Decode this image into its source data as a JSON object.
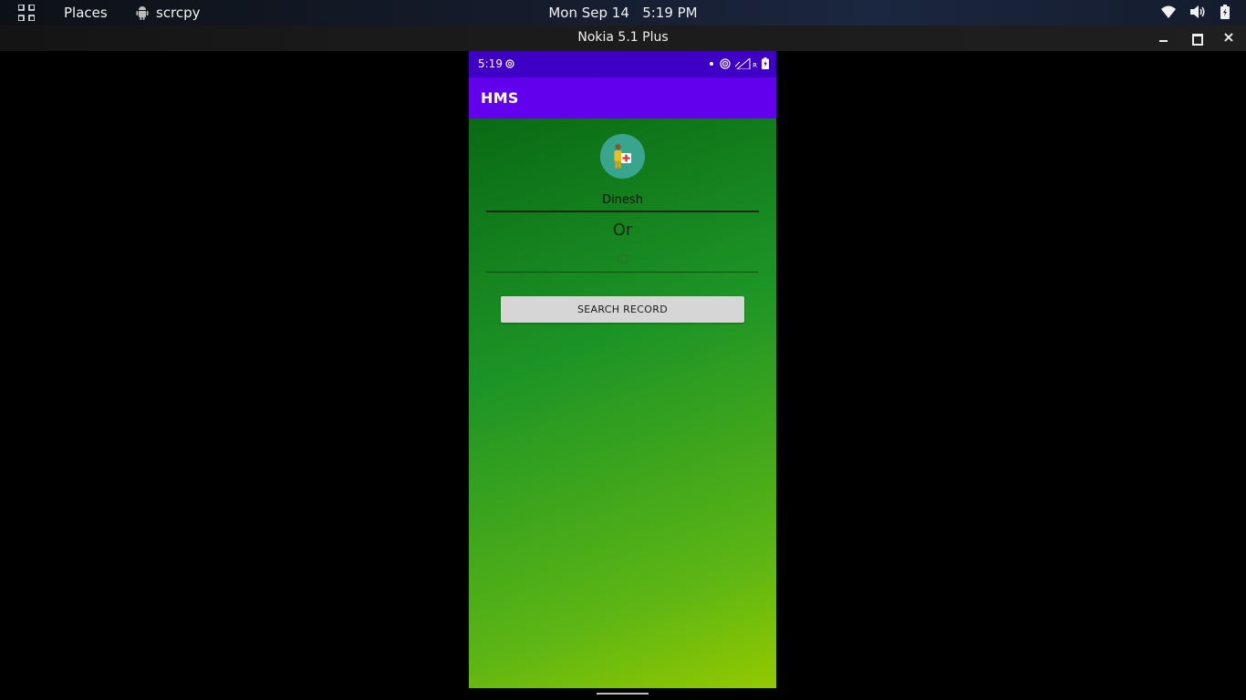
{
  "topbar": {
    "activities_icon": "apps-grid-icon",
    "places_label": "Places",
    "app_name": "scrcpy",
    "app_icon": "android-icon",
    "clock_date": "Mon Sep 14",
    "clock_time": "5:19 PM",
    "tray_icons": [
      "wifi-icon",
      "volume-icon",
      "battery-icon"
    ]
  },
  "window": {
    "title": "Nokia 5.1 Plus",
    "controls": [
      "minimize",
      "maximize",
      "close"
    ],
    "close_glyph": "×"
  },
  "phone": {
    "status_time": "5:19",
    "status_icons": [
      "notification-dot-icon",
      "hotspot-icon",
      "signal-icon",
      "battery-charging-icon"
    ],
    "status_signal_label": "R",
    "app_title": "HMS",
    "avatar_icon": "patient-medical-icon",
    "name_value": "Dinesh",
    "or_label": "Or",
    "id_placeholder": "ID",
    "search_button_label": "SEARCH RECORD"
  },
  "colors": {
    "status_bar": "#3d00c4",
    "app_bar": "#6200ee",
    "gradient_start": "#0a6a14",
    "gradient_end": "#94c900",
    "button": "#d6d6d6"
  }
}
